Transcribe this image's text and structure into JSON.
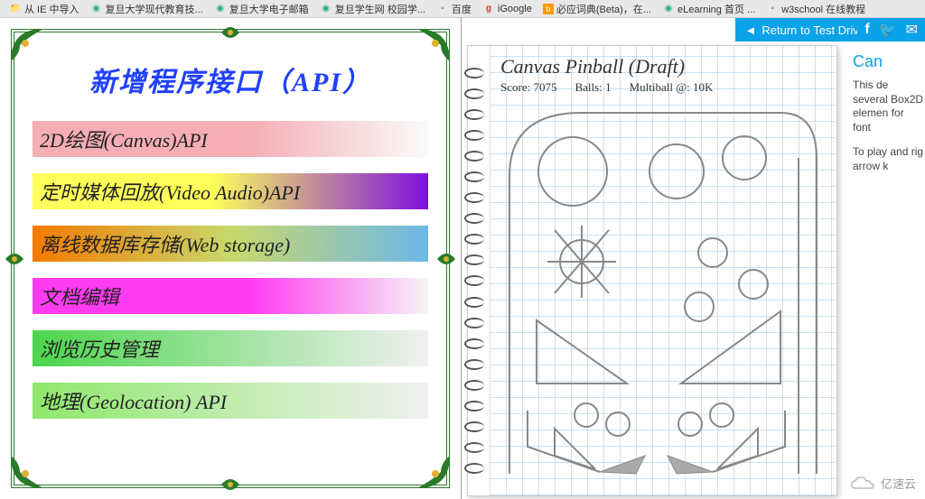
{
  "bookmarks": [
    {
      "label": "从 IE 中导入",
      "icon": "folder"
    },
    {
      "label": "复旦大学现代教育技...",
      "icon": "green"
    },
    {
      "label": "复旦大学电子邮箱",
      "icon": "green"
    },
    {
      "label": "复旦学生网 校园学...",
      "icon": "green"
    },
    {
      "label": "百度",
      "icon": "page"
    },
    {
      "label": "iGoogle",
      "icon": "google"
    },
    {
      "label": "必应词典(Beta)，在...",
      "icon": "bing"
    },
    {
      "label": "eLearning  首页 ...",
      "icon": "green"
    },
    {
      "label": "w3school 在线教程",
      "icon": "page"
    }
  ],
  "left": {
    "title": "新增程序接口（API）",
    "items": [
      "2D绘图(Canvas)API",
      "定时媒体回放(Video Audio)API",
      "离线数据库存储(Web storage)",
      "文档编辑",
      "浏览历史管理",
      "地理(Geolocation) API"
    ]
  },
  "right": {
    "return_label": "Return to Test Drive",
    "game_title": "Canvas Pinball (Draft)",
    "stats": {
      "score_label": "Score:",
      "score": "7075",
      "balls_label": "Balls:",
      "balls": "1",
      "multi_label": "Multiball @:",
      "multi": "10K"
    },
    "desc_title": "Can",
    "desc_p1": "This de several Box2D elemen for font",
    "desc_p2": "To play and rig arrow k"
  },
  "watermark": "亿速云"
}
